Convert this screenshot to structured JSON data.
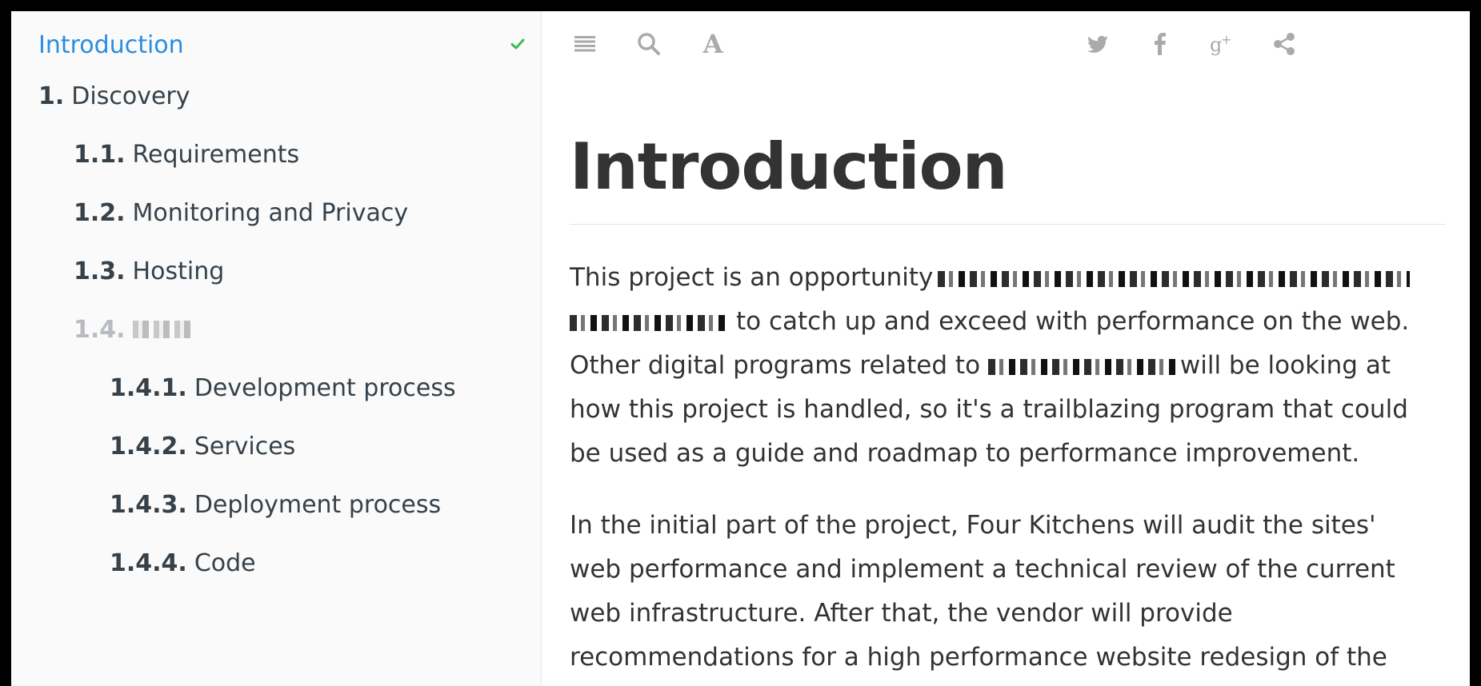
{
  "sidebar": {
    "items": [
      {
        "num": "",
        "label": "Introduction"
      },
      {
        "num": "1.",
        "label": "Discovery"
      },
      {
        "num": "1.1.",
        "label": "Requirements"
      },
      {
        "num": "1.2.",
        "label": "Monitoring and Privacy"
      },
      {
        "num": "1.3.",
        "label": "Hosting"
      },
      {
        "num": "1.4.",
        "label": ""
      },
      {
        "num": "1.4.1.",
        "label": "Development process"
      },
      {
        "num": "1.4.2.",
        "label": "Services"
      },
      {
        "num": "1.4.3.",
        "label": "Deployment process"
      },
      {
        "num": "1.4.4.",
        "label": "Code"
      }
    ]
  },
  "toolbar": {
    "menu_icon": "menu-icon",
    "search_icon": "search-icon",
    "font_icon": "font-settings-icon",
    "font_glyph": "A",
    "twitter_icon": "twitter-icon",
    "facebook_icon": "facebook-icon",
    "gplus_icon": "google-plus-icon",
    "share_icon": "share-icon"
  },
  "main": {
    "title": "Introduction",
    "p1": {
      "l1": "This project is an opportunity",
      "l2": "to catch up and exceed with performance on the web.",
      "l3a": "Other digital programs related to",
      "l3b": "will be looking at",
      "l4": "how this project is handled, so it's a trailblazing program that could",
      "l5": "be used as a guide and roadmap to performance improvement."
    },
    "p2": {
      "l1": "In the initial part of the project, Four Kitchens will audit the sites'",
      "l2": "web performance and implement a technical review of the current",
      "l3": "web infrastructure. After that, the vendor will provide",
      "l4": "recommendations for a high performance website redesign of the"
    }
  },
  "colors": {
    "accent": "#2a8de0",
    "check": "#3cba54",
    "text": "#333333",
    "sidebar_bg": "#fafafa"
  }
}
